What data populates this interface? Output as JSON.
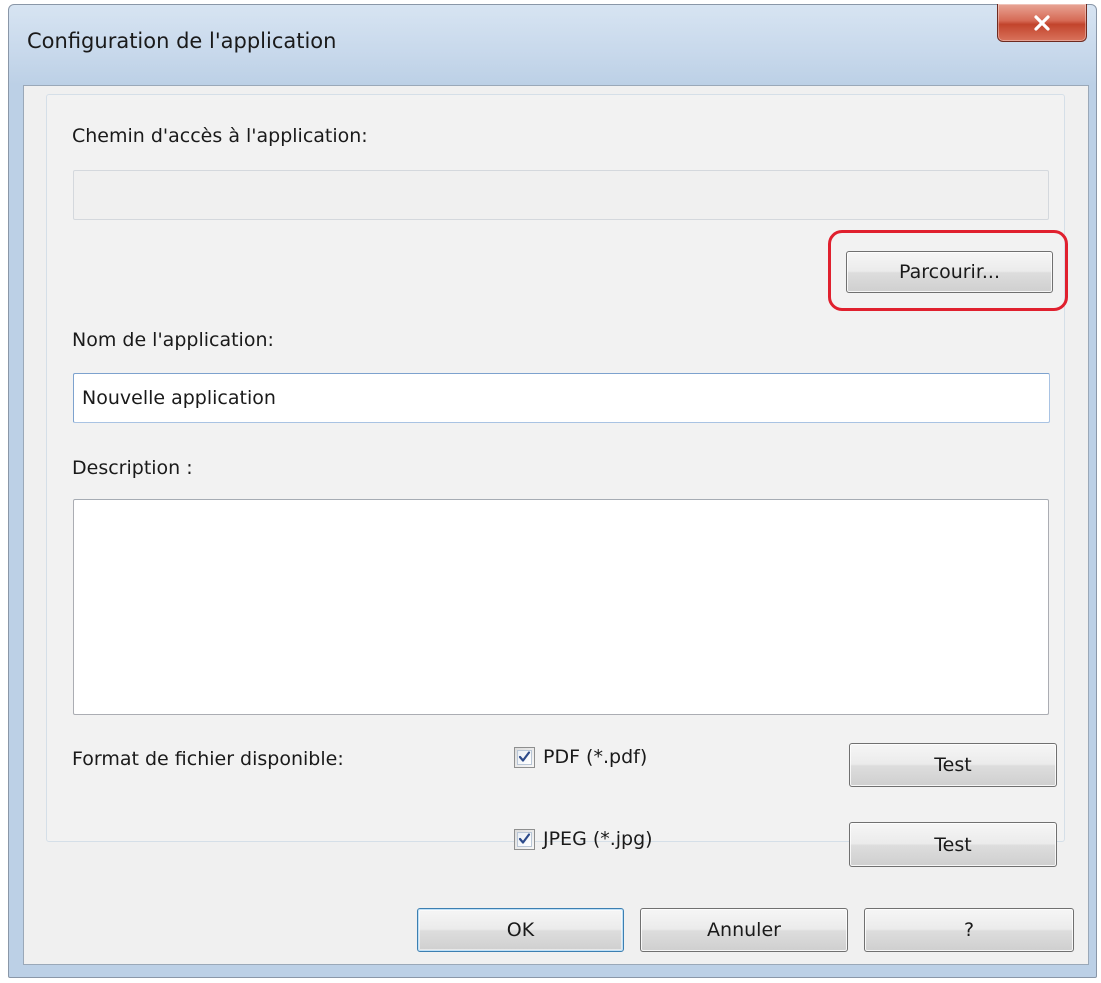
{
  "window": {
    "title": "Configuration de l'application"
  },
  "app_path": {
    "label": "Chemin d'accès à l'application:",
    "value": "",
    "browse_label": "Parcourir..."
  },
  "app_name": {
    "label": "Nom de l'application:",
    "value": "Nouvelle application"
  },
  "description": {
    "label": "Description :",
    "value": ""
  },
  "formats": {
    "label": "Format de fichier disponible:",
    "items": [
      {
        "label": "PDF (*.pdf)",
        "checked": true,
        "test_label": "Test"
      },
      {
        "label": "JPEG (*.jpg)",
        "checked": true,
        "test_label": "Test"
      }
    ]
  },
  "footer": {
    "ok_label": "OK",
    "cancel_label": "Annuler",
    "help_label": "?"
  },
  "icons": {
    "close": "close-icon",
    "checkmark": "checkmark-icon"
  },
  "colors": {
    "highlight": "#e0202e",
    "close_button": "#c2442c",
    "checkmark": "#2c4a8a"
  }
}
